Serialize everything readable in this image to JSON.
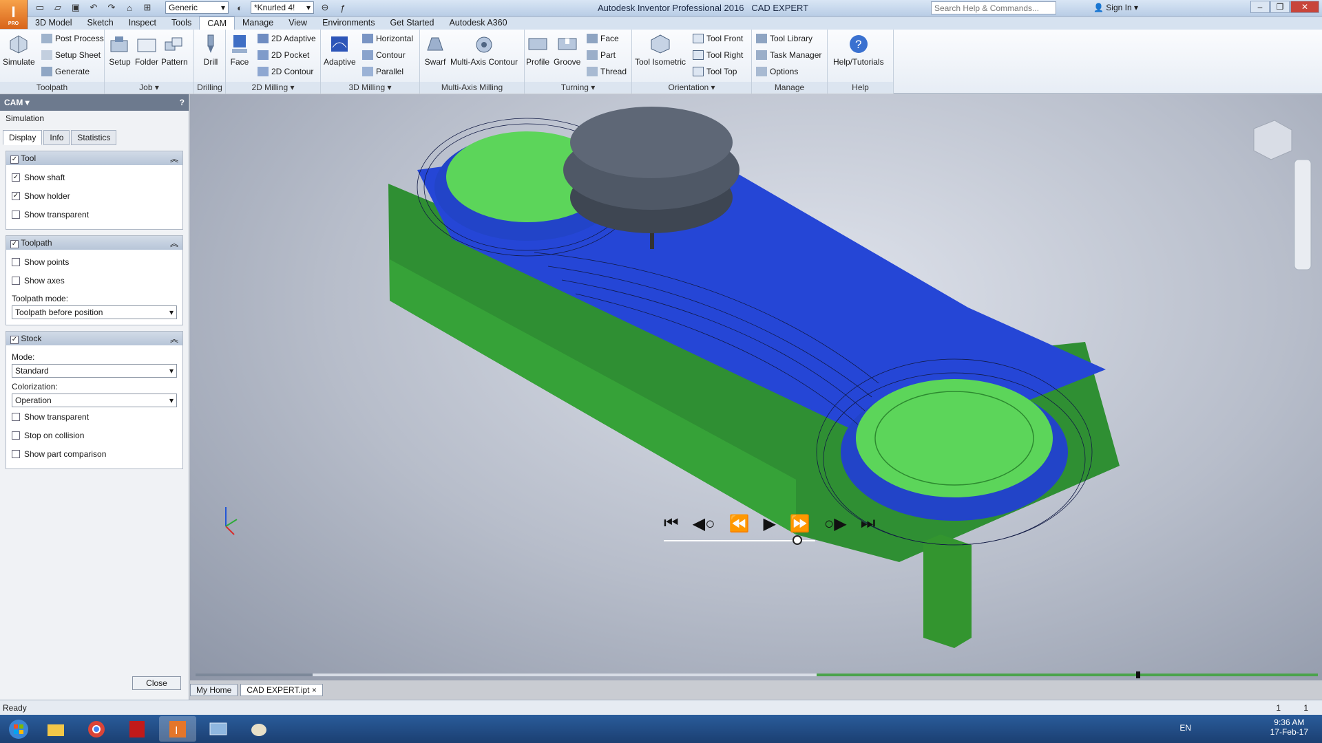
{
  "app": {
    "title": "Autodesk Inventor Professional 2016",
    "doc": "CAD EXPERT",
    "logo_letter": "I",
    "logo_sub": "PRO"
  },
  "qat": {
    "appearance": "Generic",
    "material": "*Knurled 4!"
  },
  "search": {
    "placeholder": "Search Help & Commands..."
  },
  "signin": "Sign In",
  "menu": [
    "3D Model",
    "Sketch",
    "Inspect",
    "Tools",
    "CAM",
    "Manage",
    "View",
    "Environments",
    "Get Started",
    "Autodesk A360"
  ],
  "ribbon": {
    "toolpath": {
      "label": "Toolpath",
      "simulate": "Simulate",
      "post": "Post Process",
      "setup_sheet": "Setup Sheet",
      "generate": "Generate"
    },
    "job": {
      "label": "Job",
      "setup": "Setup",
      "folder": "Folder",
      "pattern": "Pattern"
    },
    "drilling": {
      "label": "Drilling",
      "drill": "Drill"
    },
    "milling2d": {
      "label": "2D Milling",
      "face": "Face",
      "adaptive": "2D Adaptive",
      "pocket": "2D Pocket",
      "contour": "2D Contour"
    },
    "milling3d": {
      "label": "3D Milling",
      "adaptive": "Adaptive",
      "horizontal": "Horizontal",
      "contour": "Contour",
      "parallel": "Parallel"
    },
    "multiaxis": {
      "label": "Multi-Axis Milling",
      "swarf": "Swarf",
      "contour": "Multi-Axis Contour"
    },
    "turning": {
      "label": "Turning",
      "profile": "Profile",
      "groove": "Groove",
      "face": "Face",
      "part": "Part",
      "thread": "Thread"
    },
    "orientation": {
      "label": "Orientation",
      "iso": "Tool Isometric",
      "front": "Tool Front",
      "right": "Tool Right",
      "top": "Tool Top"
    },
    "manage": {
      "label": "Manage",
      "library": "Tool Library",
      "task": "Task Manager",
      "options": "Options"
    },
    "help": {
      "label": "Help",
      "tutorials": "Help/Tutorials"
    }
  },
  "side": {
    "header": "CAM",
    "subtitle": "Simulation",
    "tabs": [
      "Display",
      "Info",
      "Statistics"
    ],
    "tool": {
      "title": "Tool",
      "items": [
        {
          "label": "Show shaft",
          "checked": true
        },
        {
          "label": "Show holder",
          "checked": true
        },
        {
          "label": "Show transparent",
          "checked": false
        }
      ]
    },
    "toolpath": {
      "title": "Toolpath",
      "items": [
        {
          "label": "Show points",
          "checked": false
        },
        {
          "label": "Show axes",
          "checked": false
        }
      ],
      "mode_label": "Toolpath mode:",
      "mode": "Toolpath before position"
    },
    "stock": {
      "title": "Stock",
      "mode_label": "Mode:",
      "mode": "Standard",
      "color_label": "Colorization:",
      "color": "Operation",
      "items": [
        {
          "label": "Show transparent",
          "checked": false
        },
        {
          "label": "Stop on collision",
          "checked": false
        },
        {
          "label": "Show part comparison",
          "checked": false
        }
      ]
    },
    "close": "Close"
  },
  "doctabs": [
    "My Home",
    "CAD EXPERT.ipt"
  ],
  "status": {
    "text": "Ready",
    "n1": "1",
    "n2": "1"
  },
  "timeline": {
    "playhead": 0.84,
    "speed": 0.88
  },
  "clock": {
    "lang": "EN",
    "time": "9:36 AM",
    "date": "17-Feb-17"
  },
  "colors": {
    "part_green": "#3ea33a",
    "stock_top": "#5ed35a",
    "stock_blue": "#2746d8",
    "tool": "#4f5866"
  }
}
